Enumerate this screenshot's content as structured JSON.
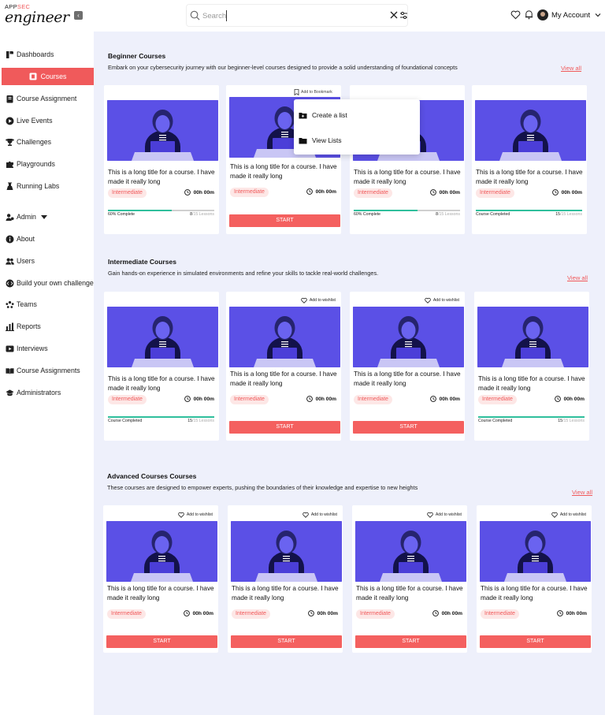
{
  "header": {
    "logo_top_a": "APP",
    "logo_top_b": "SEC",
    "logo_main": "engineer",
    "search_placeholder": "Search",
    "account_label": "My Account",
    "accent_color": "#f05a5b"
  },
  "sidebar": {
    "items": [
      {
        "label": "Dashboards",
        "icon": "dashboard-icon"
      },
      {
        "label": "Courses",
        "icon": "book-icon"
      },
      {
        "label": "Course Assignment",
        "icon": "assignment-icon"
      },
      {
        "label": "Live Events",
        "icon": "play-circle-icon"
      },
      {
        "label": "Challenges",
        "icon": "trophy-icon"
      },
      {
        "label": "Playgrounds",
        "icon": "puzzle-icon"
      },
      {
        "label": "Running Labs",
        "icon": "flask-icon"
      },
      {
        "label": "Admin",
        "icon": "admin-icon"
      },
      {
        "label": "About",
        "icon": "info-icon"
      },
      {
        "label": "Users",
        "icon": "users-icon"
      },
      {
        "label": "Build your own challenge",
        "icon": "code-icon"
      },
      {
        "label": "Teams",
        "icon": "teams-icon"
      },
      {
        "label": "Reports",
        "icon": "bar-chart-icon"
      },
      {
        "label": "Interviews",
        "icon": "video-icon"
      },
      {
        "label": "Course Assignments",
        "icon": "book-open-icon"
      },
      {
        "label": "Administrators",
        "icon": "graduation-cap-icon"
      }
    ]
  },
  "bookmark_menu": {
    "bookmark_label": "Add to Bookmark",
    "items": [
      "Create a list",
      "View Lists"
    ]
  },
  "sections": {
    "beginner": {
      "title": "Beginner Courses",
      "desc": "Embark on your cybersecurity journey with our beginner-level courses designed to provide a solid understanding of foundational concepts",
      "view_all": "View  all",
      "cards": [
        {
          "title": "This is a long title for a course. I have made it really long",
          "level": "Intermediate",
          "duration": "00h 00m",
          "progress_label": "60% Complete",
          "done": "8",
          "total": "/15 Lessons",
          "progress": 0.6
        },
        {
          "title": "This is a long title for a course. I have made it really long",
          "level": "Intermediate",
          "duration": "00h 00m",
          "start": "START"
        },
        {
          "title": "This is a long title for a course. I have made it really long",
          "level": "Intermediate",
          "duration": "00h 00m",
          "progress_label": "60% Complete",
          "done": "8",
          "total": "/15 Lessons",
          "progress": 0.6
        },
        {
          "title": "This is a long title for a course. I have made it really long",
          "level": "Intermediate",
          "duration": "00h 00m",
          "progress_label": "Course Completed",
          "done": "15",
          "total": "/15 Lessons",
          "progress": 1.0
        }
      ]
    },
    "intermediate": {
      "title": "Intermediate Courses",
      "desc": "Gain hands-on experience in simulated environments and refine your skills to tackle real-world challenges.",
      "view_all": "View  all",
      "wishlist": "Add to wishlist",
      "cards": [
        {
          "title": "This is a long title for a course. I have made it really long",
          "level": "Intermediate",
          "duration": "00h 00m",
          "progress_label": "Course Completed",
          "done": "15",
          "total": "/15 Lessons",
          "progress": 1.0
        },
        {
          "title": "This is a long title for a course. I have made it really long",
          "level": "Intermediate",
          "duration": "00h 00m",
          "start": "START"
        },
        {
          "title": "This is a long title for a course. I have made it really long",
          "level": "Intermediate",
          "duration": "00h 00m",
          "start": "START"
        },
        {
          "title": "This is a long title for a course. I have made it really long",
          "level": "Intermediate",
          "duration": "00h 00m",
          "progress_label": "Course Completed",
          "done": "15",
          "total": "/15 Lessons",
          "progress": 1.0
        }
      ]
    },
    "advanced": {
      "title": "Advanced Courses Courses",
      "desc": "These courses are designed to empower experts, pushing the boundaries of their knowledge and expertise to new heights",
      "view_all": "View  all",
      "wishlist": "Add to wishlist",
      "cards": [
        {
          "title": "This is a long title for a course. I have made it really long",
          "level": "Intermediate",
          "duration": "00h 00m",
          "start": "START"
        },
        {
          "title": "This is a long title for a course. I have made it really long",
          "level": "Intermediate",
          "duration": "00h 00m",
          "start": "START"
        },
        {
          "title": "This is a long title for a course. I have made it really long",
          "level": "Intermediate",
          "duration": "00h 00m",
          "start": "START"
        },
        {
          "title": "This is a long title for a course. I have made it really long",
          "level": "Intermediate",
          "duration": "00h 00m",
          "start": "START"
        }
      ]
    }
  }
}
